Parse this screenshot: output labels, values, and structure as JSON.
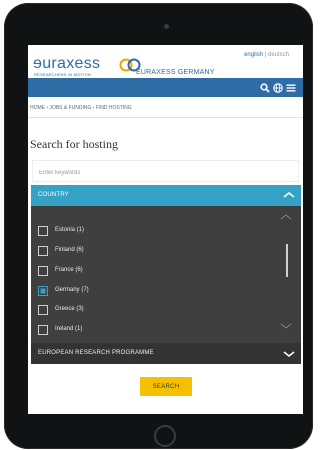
{
  "header": {
    "logo_text": "ɘuraxess",
    "logo_tagline": "RESEARCHERS IN MOTION",
    "site_name": "EURAXESS GERMANY",
    "lang_active": "english",
    "lang_separator": " | ",
    "lang_other": "deutsch"
  },
  "nav": {
    "icons": [
      "search-icon",
      "globe-icon",
      "menu-icon"
    ]
  },
  "breadcrumb": "HOME › JOBS & FUNDING › FIND HOSTING",
  "page_title": "Search for hosting",
  "search": {
    "placeholder": "Enter keywords",
    "value": ""
  },
  "country_filter": {
    "label": "COUNTRY",
    "items": [
      {
        "label": "Estonia (1)",
        "checked": false
      },
      {
        "label": "Finland (6)",
        "checked": false
      },
      {
        "label": "France (6)",
        "checked": false
      },
      {
        "label": "Germany (7)",
        "checked": true
      },
      {
        "label": "Greece (3)",
        "checked": false
      },
      {
        "label": "Ireland (1)",
        "checked": false
      }
    ]
  },
  "programme_filter": {
    "label": "EUROPEAN RESEARCH PROGRAMME"
  },
  "search_button": "SEARCH",
  "colors": {
    "brand_blue": "#2e6ca5",
    "accent_cyan": "#35a2c5",
    "dark_panel": "#3f3f3f",
    "button_yellow": "#f5c000"
  }
}
